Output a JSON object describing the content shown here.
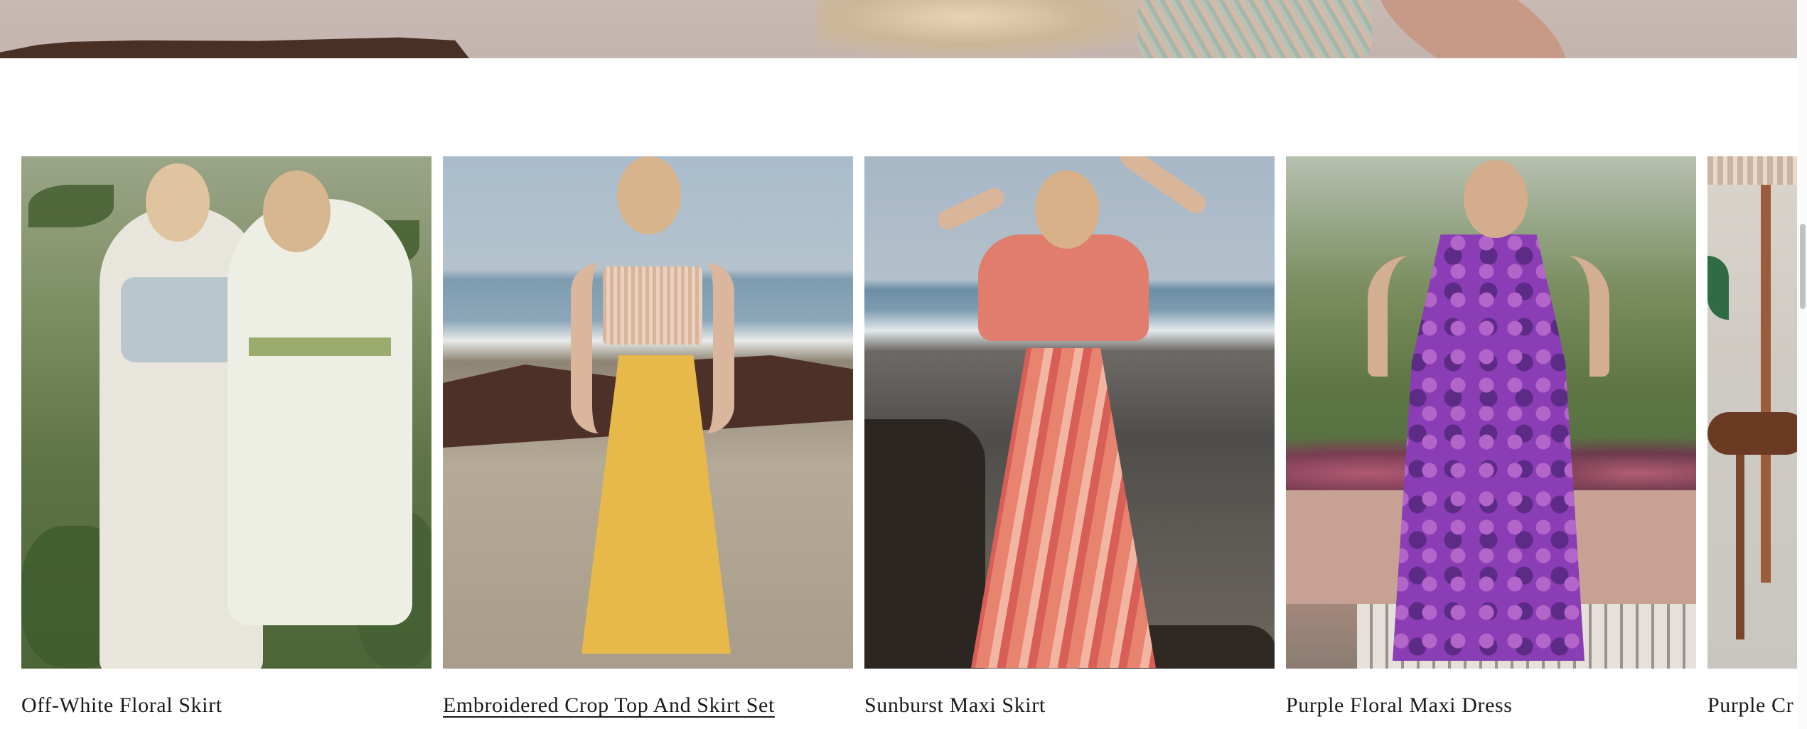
{
  "products": [
    {
      "title": "Off-White Floral Skirt"
    },
    {
      "title": "Embroidered Crop Top And Skirt Set"
    },
    {
      "title": "Sunburst Maxi Skirt"
    },
    {
      "title": "Purple Floral Maxi Dress"
    },
    {
      "title": "Purple Cr"
    }
  ]
}
